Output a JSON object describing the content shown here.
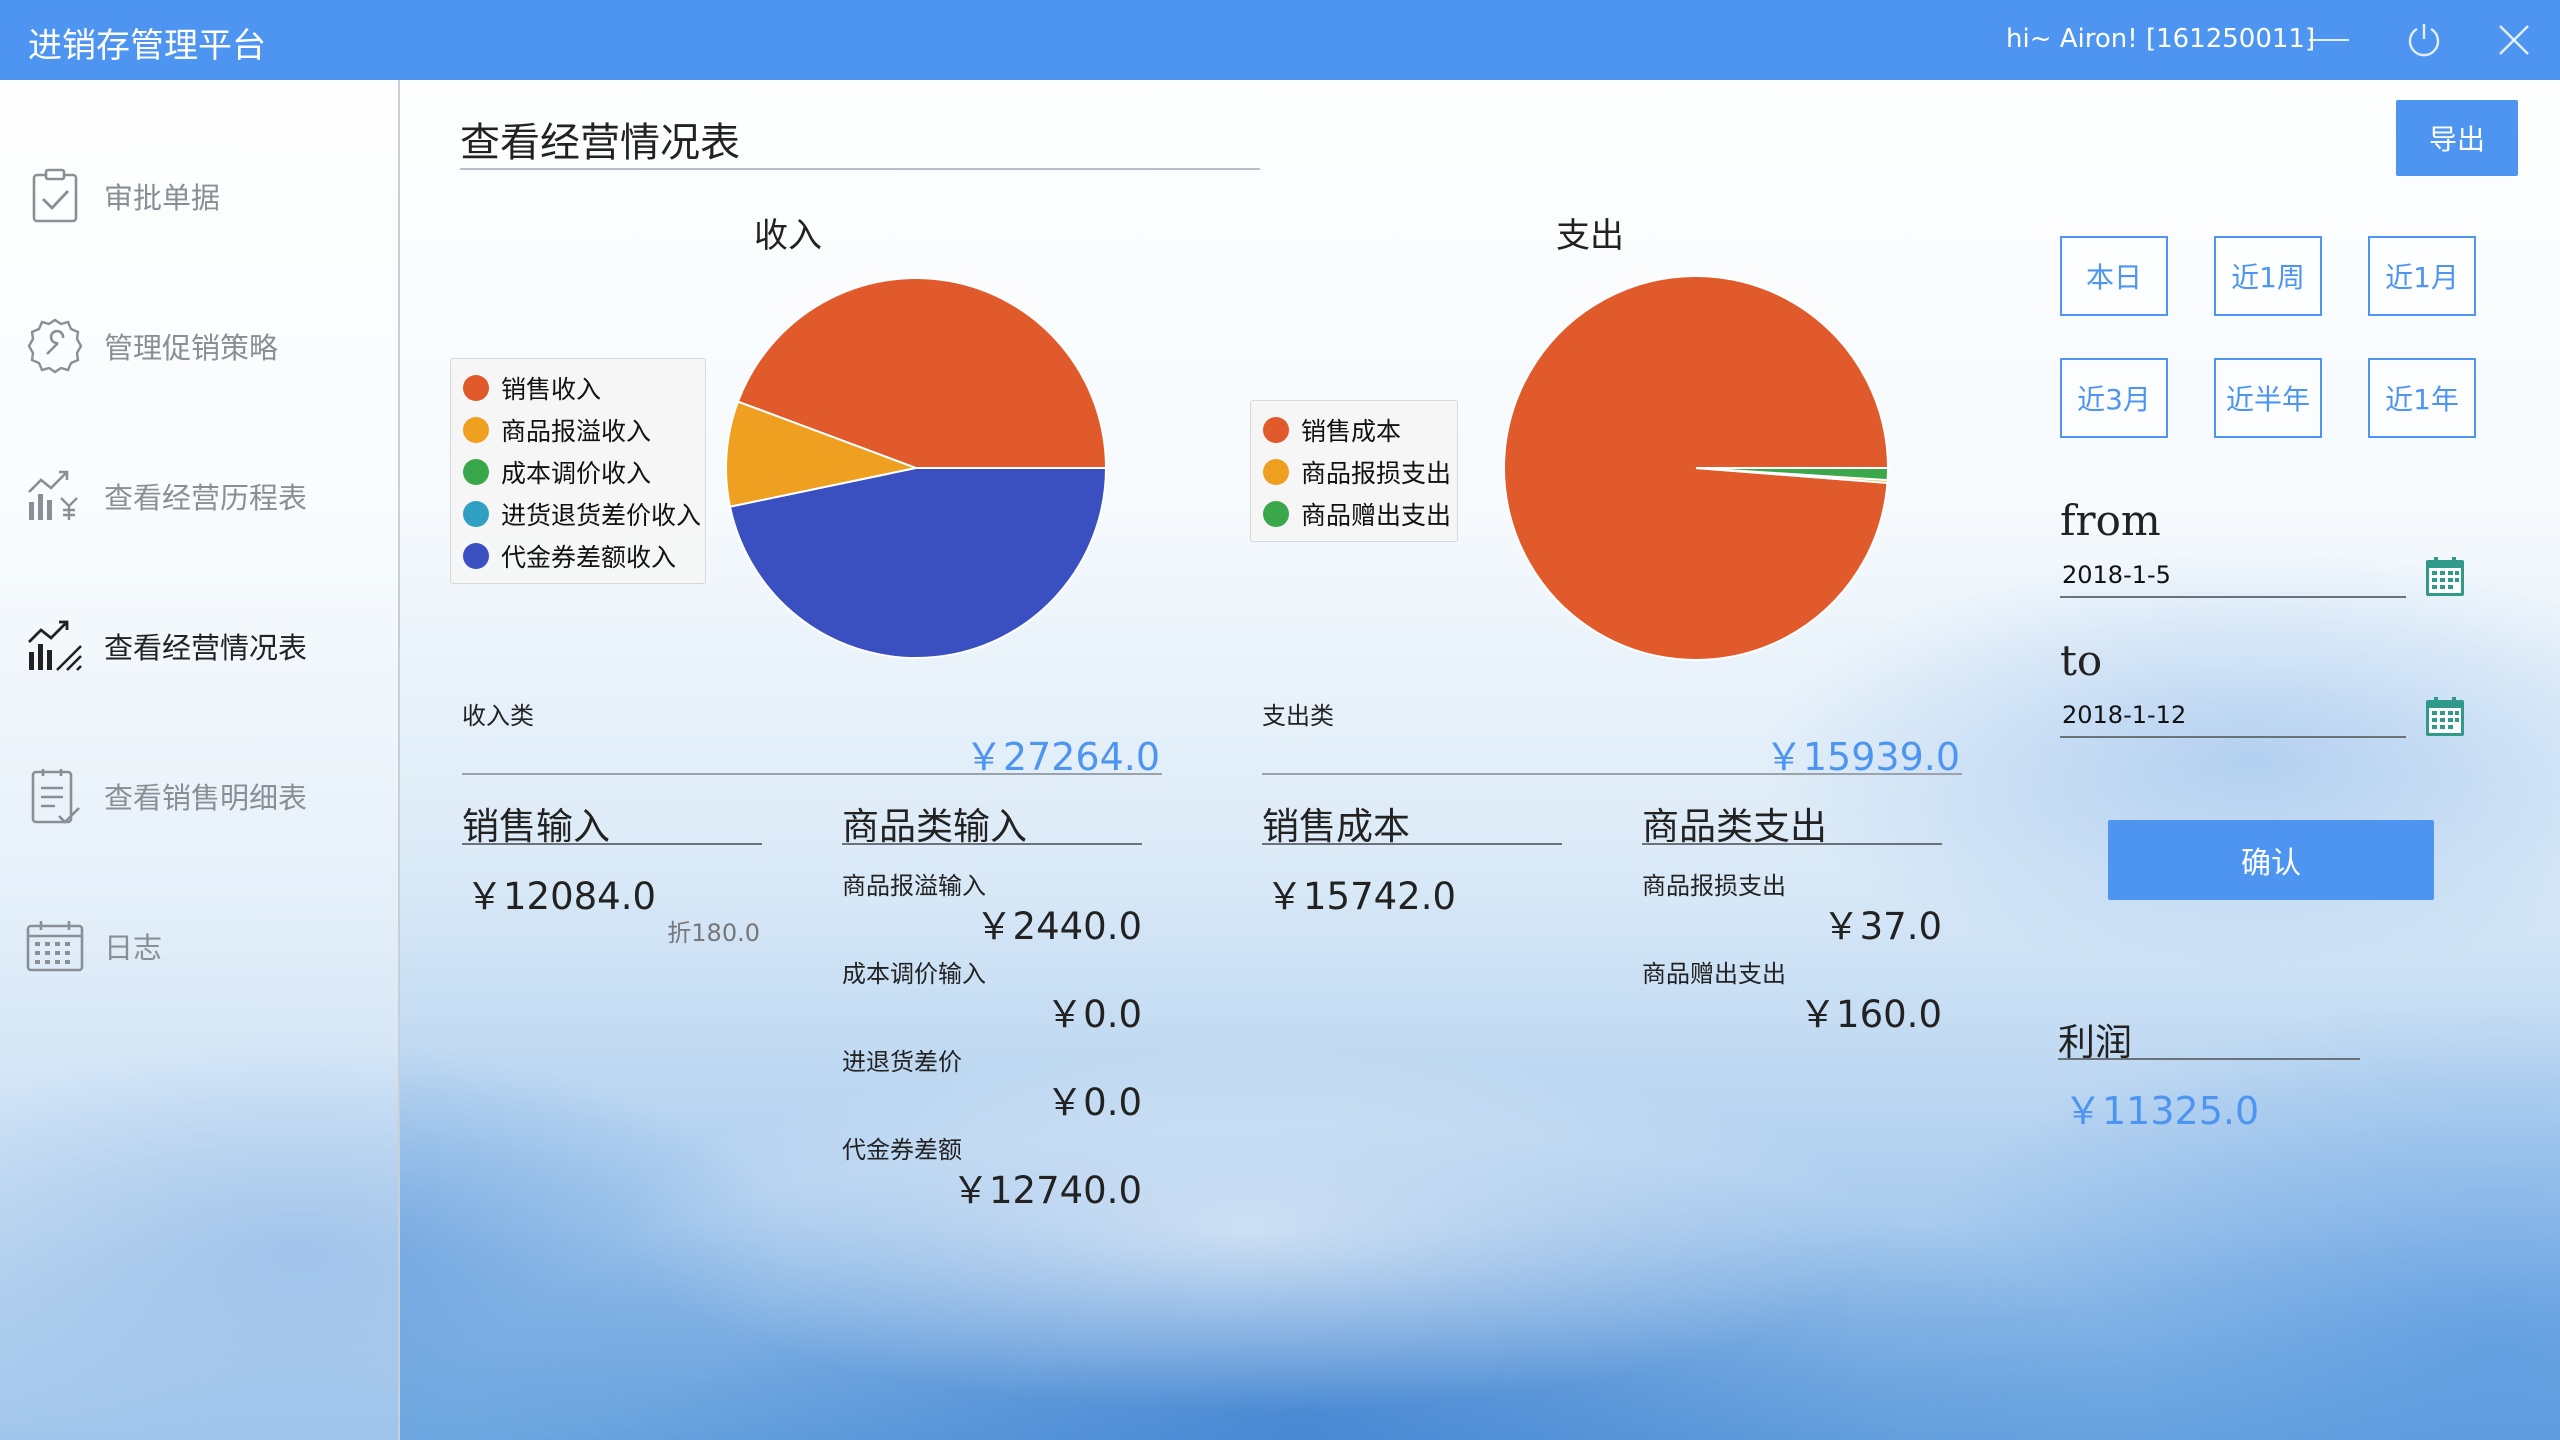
{
  "app": {
    "title": "进销存管理平台",
    "user": "hi~ Airon! [161250011]"
  },
  "sidebar": {
    "items": [
      {
        "label": "审批单据",
        "icon": "clipboard-check-icon",
        "active": false
      },
      {
        "label": "管理促销策略",
        "icon": "gear-wrench-icon",
        "active": false
      },
      {
        "label": "查看经营历程表",
        "icon": "chart-yen-icon",
        "active": false
      },
      {
        "label": "查看经营情况表",
        "icon": "chart-trend-icon",
        "active": true
      },
      {
        "label": "查看销售明细表",
        "icon": "document-list-icon",
        "active": false
      },
      {
        "label": "日志",
        "icon": "calendar-icon",
        "active": false
      }
    ]
  },
  "page": {
    "title": "查看经营情况表",
    "export_label": "导出"
  },
  "income_chart": {
    "title": "收入",
    "legend": [
      {
        "label": "销售收入",
        "color": "#e05a2b"
      },
      {
        "label": "商品报溢收入",
        "color": "#f0a020"
      },
      {
        "label": "成本调价收入",
        "color": "#3aa84a"
      },
      {
        "label": "进货退货差价收入",
        "color": "#2f9fc4"
      },
      {
        "label": "代金券差额收入",
        "color": "#3a4fc0"
      }
    ]
  },
  "expense_chart": {
    "title": "支出",
    "legend": [
      {
        "label": "销售成本",
        "color": "#e05a2b"
      },
      {
        "label": "商品报损支出",
        "color": "#f0a020"
      },
      {
        "label": "商品赠出支出",
        "color": "#3aa84a"
      }
    ]
  },
  "chart_data": [
    {
      "type": "pie",
      "title": "收入",
      "categories": [
        "销售收入",
        "商品报溢收入",
        "成本调价收入",
        "进货退货差价收入",
        "代金券差额收入"
      ],
      "values": [
        12084.0,
        2440.0,
        0.0,
        0.0,
        12740.0
      ],
      "colors": [
        "#e05a2b",
        "#f0a020",
        "#3aa84a",
        "#2f9fc4",
        "#3a4fc0"
      ],
      "legend": "left"
    },
    {
      "type": "pie",
      "title": "支出",
      "categories": [
        "销售成本",
        "商品报损支出",
        "商品赠出支出"
      ],
      "values": [
        15742.0,
        37.0,
        160.0
      ],
      "colors": [
        "#e05a2b",
        "#f0a020",
        "#3aa84a"
      ],
      "legend": "left"
    }
  ],
  "income": {
    "category_label": "收入类",
    "total": "￥27264.0",
    "sales": {
      "header": "销售输入",
      "amount": "￥12084.0",
      "discount": "折180.0"
    },
    "goods": {
      "header": "商品类输入",
      "rows": [
        {
          "label": "商品报溢输入",
          "amount": "￥2440.0"
        },
        {
          "label": "成本调价输入",
          "amount": "￥0.0"
        },
        {
          "label": "进退货差价",
          "amount": "￥0.0"
        },
        {
          "label": "代金券差额",
          "amount": "￥12740.0"
        }
      ]
    }
  },
  "expense": {
    "category_label": "支出类",
    "total": "￥15939.0",
    "sales_cost": {
      "header": "销售成本",
      "amount": "￥15742.0"
    },
    "goods": {
      "header": "商品类支出",
      "rows": [
        {
          "label": "商品报损支出",
          "amount": "￥37.0"
        },
        {
          "label": "商品赠出支出",
          "amount": "￥160.0"
        }
      ]
    }
  },
  "filters": {
    "ranges": [
      "本日",
      "近1周",
      "近1月",
      "近3月",
      "近半年",
      "近1年"
    ],
    "from_label": "from",
    "from_value": "2018-1-5",
    "to_label": "to",
    "to_value": "2018-1-12",
    "confirm_label": "确认"
  },
  "profit": {
    "label": "利润",
    "value": "￥11325.0"
  },
  "colors": {
    "accent": "#4e95f2"
  }
}
